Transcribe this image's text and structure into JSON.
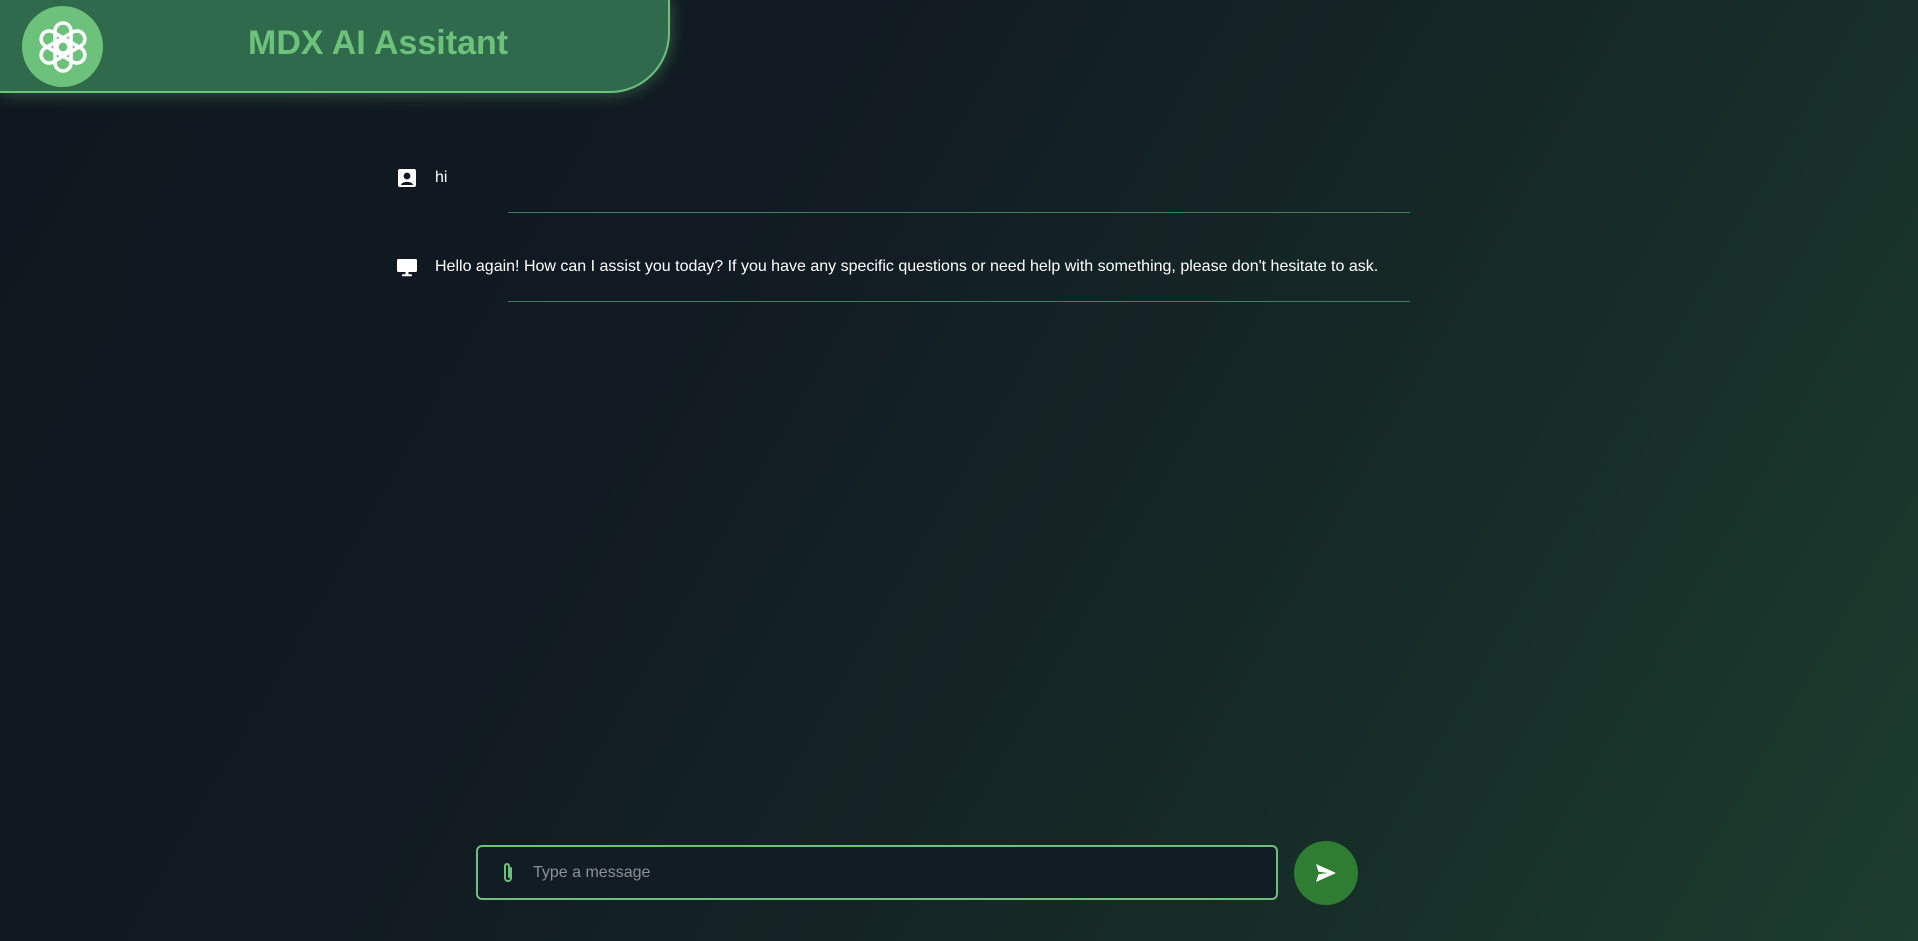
{
  "app": {
    "title": "MDX AI Assitant",
    "logo_icon": "openai-logo-icon"
  },
  "messages": [
    {
      "role": "user",
      "icon": "user-contact-icon",
      "text": "hi"
    },
    {
      "role": "assistant",
      "icon": "monitor-icon",
      "text": "Hello again! How can I assist you today? If you have any specific questions or need help with something, please don't hesitate to ask."
    }
  ],
  "composer": {
    "placeholder": "Type a message",
    "value": "",
    "attach_icon": "paperclip-icon",
    "send_icon": "send-icon"
  },
  "colors": {
    "accent": "#6cc27a",
    "header_bg": "#2f6a4c",
    "send_button": "#2e7d32",
    "divider": "#3f7f5a"
  }
}
